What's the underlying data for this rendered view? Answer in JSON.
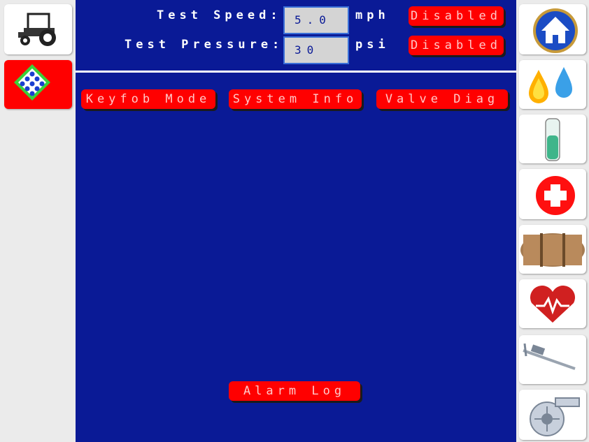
{
  "test_speed": {
    "label": "Test Speed:",
    "value": "5.0",
    "unit": "mph",
    "status": "Disabled"
  },
  "test_pressure": {
    "label": "Test Pressure:",
    "value": "30",
    "unit": "psi",
    "status": "Disabled"
  },
  "buttons": {
    "keyfob_mode": "Keyfob Mode",
    "system_info": "System Info",
    "valve_diag": "Valve Diag",
    "alarm_log": "Alarm Log"
  },
  "left_nav": [
    {
      "icon": "tractor-icon"
    },
    {
      "icon": "diamond-nozzle-icon",
      "active": true
    }
  ],
  "right_nav": [
    {
      "icon": "home-icon"
    },
    {
      "icon": "fuel-drop-icon"
    },
    {
      "icon": "test-tube-icon"
    },
    {
      "icon": "medical-cross-icon"
    },
    {
      "icon": "tank-icon"
    },
    {
      "icon": "heart-rate-icon"
    },
    {
      "icon": "caliper-icon"
    },
    {
      "icon": "flow-meter-icon"
    }
  ],
  "colors": {
    "background": "#0a1a96",
    "button": "#ff0000",
    "field": "#d4d4d4",
    "sidebar": "#ebebeb"
  }
}
